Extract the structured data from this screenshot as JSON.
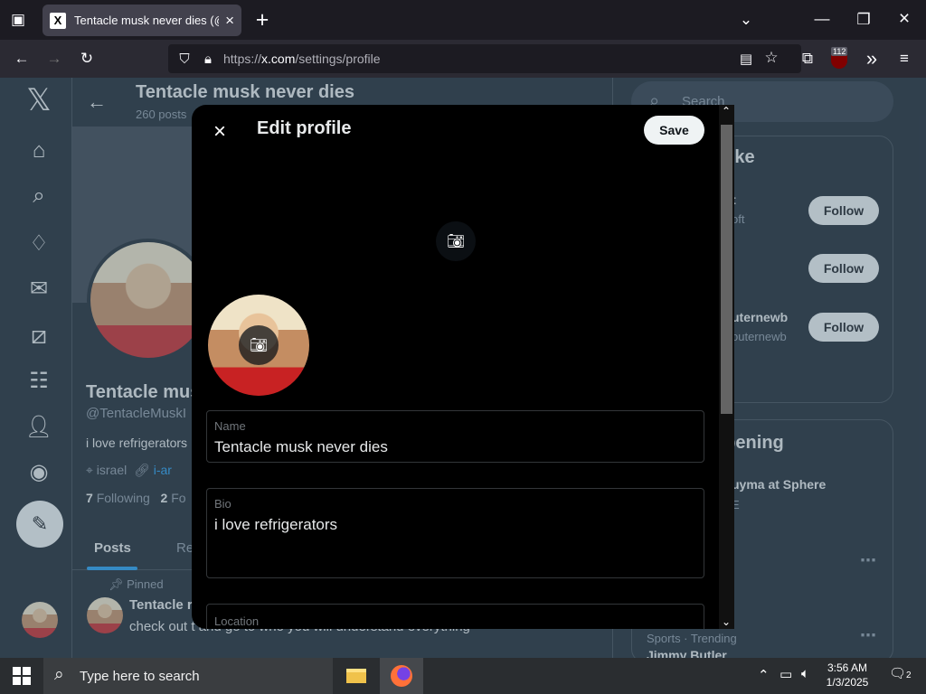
{
  "browser": {
    "tab_title": "Tentacle musk never dies (@Ter",
    "tab_favicon": "X",
    "url_prefix": "https://",
    "url_host": "x.com",
    "url_path": "/settings/profile",
    "ublock_count": "112"
  },
  "profile_page": {
    "header_title": "Tentacle musk never dies",
    "header_sub": "260 posts",
    "name": "Tentacle mus",
    "handle": "@TentacleMuskI",
    "bio": "i love refrigerators",
    "location": "israel",
    "link": "i-ar",
    "following_count": "7",
    "following_label": "Following",
    "followers_count": "2",
    "followers_label": "Fo",
    "tabs": [
      "Posts",
      "Re"
    ],
    "pinned_label": "Pinned",
    "post_author": "Tentacle r",
    "post_text": "check out t                                    and go to who you will understand everything"
  },
  "right_sidebar": {
    "search_placeholder": "Search",
    "follow_heading": "t like",
    "follow_rows": [
      {
        "name": "t",
        "handle": "oft",
        "button": "Follow"
      },
      {
        "name": "",
        "handle": "",
        "button": "Follow"
      },
      {
        "name": "uternewb",
        "handle": "outernewb",
        "button": "Follow"
      }
    ],
    "trending_heading": "ppening",
    "trending_item": "uyma at Sphere",
    "trending_sub": "E",
    "sports_label": "Sports · Trending",
    "sports_topic": "Jimmy Butler"
  },
  "modal": {
    "title": "Edit profile",
    "save_label": "Save",
    "fields": {
      "name": {
        "label": "Name",
        "value": "Tentacle musk never dies"
      },
      "bio": {
        "label": "Bio",
        "value": "i love refrigerators"
      },
      "location": {
        "label": "Location",
        "value": ""
      }
    }
  },
  "taskbar": {
    "search_placeholder": "Type here to search",
    "time": "3:56 AM",
    "date": "1/3/2025",
    "notification_count": "2"
  }
}
